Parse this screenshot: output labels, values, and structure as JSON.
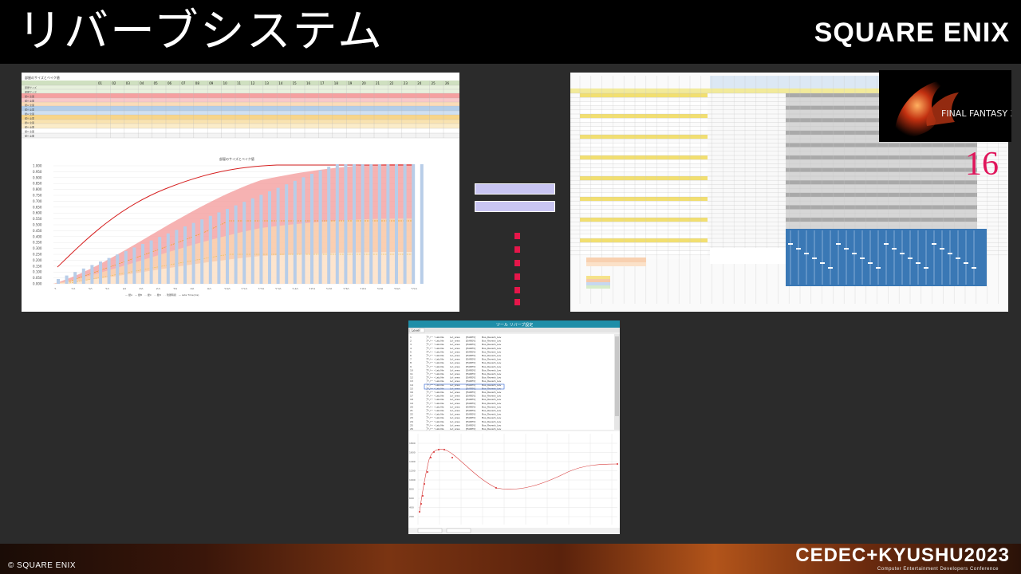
{
  "slide": {
    "title": "リバーブシステム",
    "logo_text": "SQUARE ENIX",
    "copyright": "© SQUARE ENIX",
    "event_logo": "CEDEC+KYUSHU2023",
    "event_sub": "Computer Entertainment Developers Conference",
    "accent_color": "#e6164a"
  },
  "left_panel": {
    "sheet_title": "部屋のサイズとベイク値",
    "chart_title": "部屋のサイズとベイク値",
    "column_headers": [
      "01",
      "02",
      "03",
      "04",
      "05",
      "06",
      "07",
      "08",
      "09",
      "10",
      "11",
      "12",
      "13",
      "14",
      "15",
      "16",
      "17",
      "18",
      "19",
      "20",
      "21",
      "22",
      "23",
      "24",
      "25",
      "26"
    ],
    "x_ticks": [
      "3",
      "10",
      "20",
      "30",
      "40",
      "50",
      "60",
      "70",
      "80",
      "90",
      "100",
      "110",
      "120",
      "130",
      "140",
      "150",
      "160",
      "170",
      "180",
      "190",
      "200",
      "210"
    ],
    "y_ticks": [
      "1.000",
      "0.950",
      "0.900",
      "0.850",
      "0.800",
      "0.750",
      "0.700",
      "0.650",
      "0.600",
      "0.550",
      "0.500",
      "0.450",
      "0.400",
      "0.350",
      "0.300",
      "0.250",
      "0.200",
      "0.150",
      "0.100",
      "0.050",
      "0.000"
    ]
  },
  "right_panel": {
    "game_logo": "FINAL FANTASY XVI",
    "badge": "16"
  },
  "bottom_panel": {
    "window_title": "ツール リバーブ設定",
    "tab_label": "Level",
    "y_ticks": [
      "1800",
      "1600",
      "1400",
      "1200",
      "1000",
      "800",
      "600",
      "400",
      "200"
    ]
  }
}
